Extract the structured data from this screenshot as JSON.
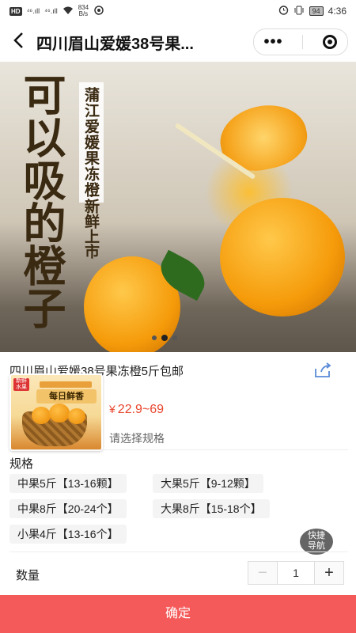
{
  "status_bar": {
    "left_badge": "HD",
    "signal1": "⁴⁶.ıll",
    "signal2": "⁴⁶.ıll",
    "speed_value": "834",
    "speed_unit": "B/s",
    "battery": "94",
    "time": "4:36"
  },
  "nav": {
    "back_icon": "chevron-left-icon",
    "title": "四川眉山爱媛38号果...",
    "more_label": "•••",
    "target_icon": "record-icon"
  },
  "banner": {
    "big_text": "可以吸的橙子",
    "small_text": "蒲江爱媛果冻橙",
    "new_text": "·新鲜上市",
    "slide_count": 3,
    "active_slide": 1
  },
  "product": {
    "title": "四川眉山爱媛38号果冻橙5斤包邮",
    "share_icon": "share-icon",
    "thumb_brand": "新鲜水果",
    "thumb_text": "每日鲜香",
    "price_symbol": "¥",
    "price_range": "22.9~69",
    "select_hint": "请选择规格"
  },
  "spec": {
    "label": "规格",
    "options": [
      "中果5斤【13-16颗】",
      "大果5斤【9-12颗】",
      "中果8斤【20-24个】",
      "大果8斤【15-18个】",
      "小果4斤【13-16个】"
    ]
  },
  "fab": {
    "line1": "快捷",
    "line2": "导航"
  },
  "quantity": {
    "label": "数量",
    "minus": "−",
    "value": "1",
    "plus": "+"
  },
  "footer": {
    "confirm_label": "确定"
  },
  "colors": {
    "accent": "#f55a5a",
    "price": "#e8462e"
  }
}
